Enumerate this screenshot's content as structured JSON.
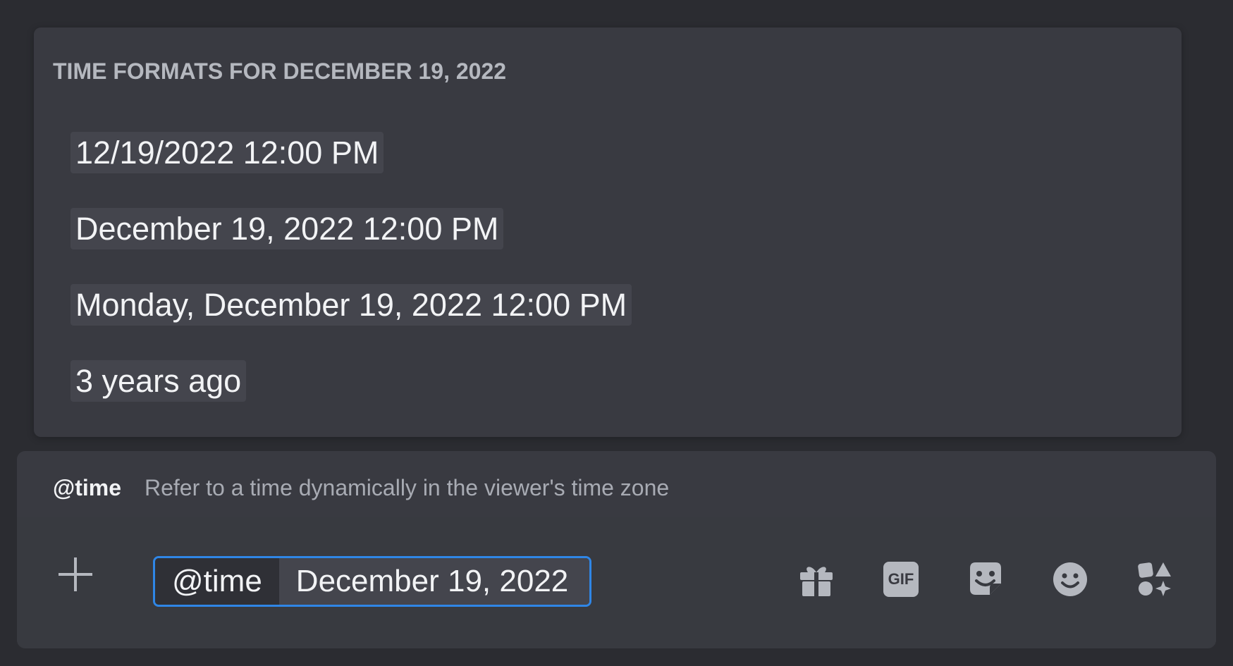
{
  "popup": {
    "title": "TIME FORMATS FOR DECEMBER 19, 2022",
    "formats": [
      "12/19/2022 12:00 PM",
      "December 19, 2022 12:00 PM",
      "Monday, December 19, 2022 12:00 PM",
      "3 years ago"
    ]
  },
  "suggestion": {
    "command": "@time",
    "description": "Refer to a time dynamically in the viewer's time zone"
  },
  "composer": {
    "chip_command": "@time",
    "chip_argument": "December 19, 2022",
    "gif_label": "GIF",
    "icons": [
      "plus-icon",
      "gift-icon",
      "gif-icon",
      "sticker-icon",
      "emoji-icon",
      "apps-icon"
    ]
  },
  "colors": {
    "background": "#2b2c31",
    "panel": "#393a41",
    "chip_highlight": "#44454d",
    "focus_border": "#2f86e6",
    "text_primary": "#f2f3f5",
    "text_muted": "#b5b8bf"
  }
}
